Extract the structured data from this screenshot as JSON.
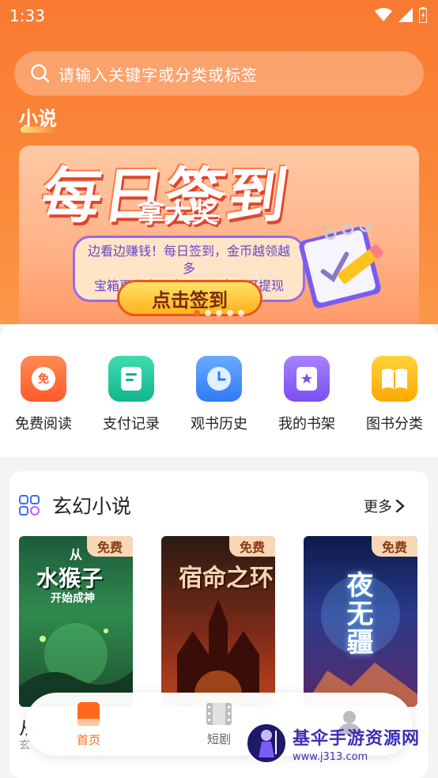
{
  "status": {
    "time": "1:33"
  },
  "search": {
    "placeholder": "请输入关键字或分类或标签"
  },
  "section": {
    "label": "小说"
  },
  "banner": {
    "title": "每日签到",
    "subtitle": "拿大奖",
    "desc_line1": "边看边赚钱！每日签到，金币越领越多",
    "desc_line2": "宝箱更有大量金币等你拿！可提现",
    "button": "点击签到",
    "page_count": 5,
    "active_page": 1
  },
  "quick": [
    {
      "label": "免费阅读",
      "icon": "free-read-icon",
      "color": "#ff6b35",
      "glyph": "免"
    },
    {
      "label": "支付记录",
      "icon": "payment-record-icon",
      "color": "#1ec29a",
      "glyph": ""
    },
    {
      "label": "观书历史",
      "icon": "history-clock-icon",
      "color": "#3d8bff",
      "glyph": ""
    },
    {
      "label": "我的书架",
      "icon": "bookshelf-icon",
      "color": "#8a5cf5",
      "glyph": ""
    },
    {
      "label": "图书分类",
      "icon": "book-category-icon",
      "color": "#ffb400",
      "glyph": ""
    }
  ],
  "category": {
    "title": "玄幻小说",
    "more": "更多"
  },
  "books": [
    {
      "cover_line1": "从",
      "cover_line2": "水猴子",
      "cover_line3": "开始成神",
      "tag": "免费"
    },
    {
      "cover_title": "宿命之环",
      "tag": "免费"
    },
    {
      "cover_title": "夜无疆",
      "tag": "免费"
    }
  ],
  "first_book": {
    "name_fragment": "从",
    "cat_fragment": "玄"
  },
  "nav": [
    {
      "label": "首页",
      "icon": "home-book-icon",
      "active": true
    },
    {
      "label": "短剧",
      "icon": "short-drama-icon",
      "active": false
    },
    {
      "label": "",
      "icon": "profile-icon",
      "active": false
    }
  ],
  "watermark": {
    "main": "基伞手游资源网",
    "url": "www.j313.com"
  },
  "colors": {
    "accent": "#ff6a1a",
    "orange_bg": "#fb8a3b"
  }
}
